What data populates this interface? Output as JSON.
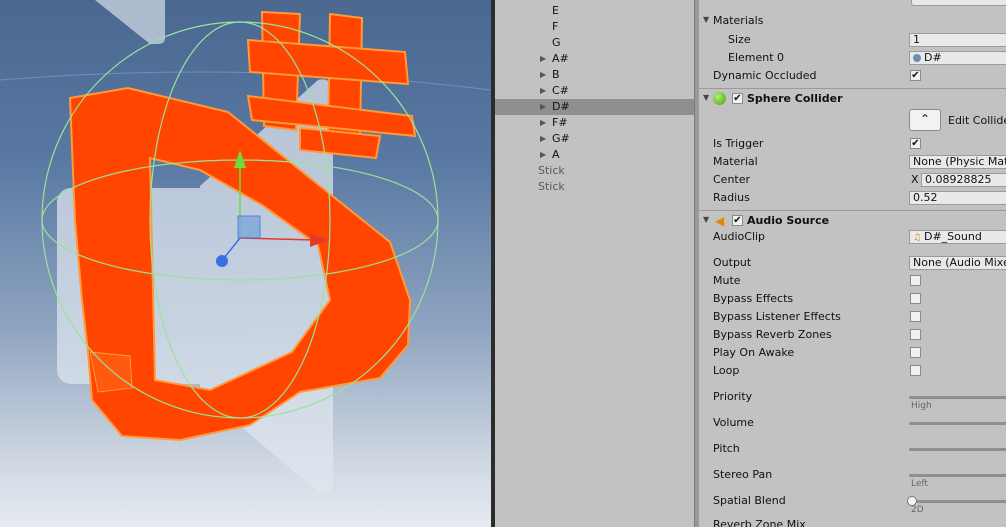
{
  "hierarchy": {
    "items": [
      {
        "label": "E",
        "expandable": false,
        "selected": false,
        "dim": false
      },
      {
        "label": "F",
        "expandable": false,
        "selected": false,
        "dim": false
      },
      {
        "label": "G",
        "expandable": false,
        "selected": false,
        "dim": false
      },
      {
        "label": "A#",
        "expandable": true,
        "selected": false,
        "dim": false
      },
      {
        "label": "B",
        "expandable": true,
        "selected": false,
        "dim": false
      },
      {
        "label": "C#",
        "expandable": true,
        "selected": false,
        "dim": false
      },
      {
        "label": "D#",
        "expandable": true,
        "selected": true,
        "dim": false
      },
      {
        "label": "F#",
        "expandable": true,
        "selected": false,
        "dim": false
      },
      {
        "label": "G#",
        "expandable": true,
        "selected": false,
        "dim": false
      },
      {
        "label": "A",
        "expandable": true,
        "selected": false,
        "dim": false
      },
      {
        "label": "Stick",
        "expandable": false,
        "selected": false,
        "dim": true
      },
      {
        "label": "Stick",
        "expandable": false,
        "selected": false,
        "dim": true
      }
    ]
  },
  "inspector": {
    "mesh_renderer": {
      "materials_label": "Materials",
      "size_label": "Size",
      "size_value": "1",
      "element0_label": "Element 0",
      "element0_value": "D#",
      "dynamic_occluded_label": "Dynamic Occluded",
      "dynamic_occluded_checked": true
    },
    "sphere_collider": {
      "title": "Sphere Collider",
      "enabled": true,
      "edit_collider_label": "Edit Collider",
      "is_trigger_label": "Is Trigger",
      "is_trigger_checked": true,
      "material_label": "Material",
      "material_value": "None (Physic Material)",
      "center_label": "Center",
      "center_axis": "X",
      "center_x": "0.08928825",
      "radius_label": "Radius",
      "radius_value": "0.52"
    },
    "audio_source": {
      "title": "Audio Source",
      "enabled": true,
      "audioclip_label": "AudioClip",
      "audioclip_value": "D#_Sound",
      "output_label": "Output",
      "output_value": "None (Audio Mixer Group)",
      "mute_label": "Mute",
      "bypass_effects_label": "Bypass Effects",
      "bypass_listener_label": "Bypass Listener Effects",
      "bypass_reverb_label": "Bypass Reverb Zones",
      "play_on_awake_label": "Play On Awake",
      "loop_label": "Loop",
      "priority_label": "Priority",
      "priority_hint": "High",
      "volume_label": "Volume",
      "pitch_label": "Pitch",
      "stereo_pan_label": "Stereo Pan",
      "stereo_pan_hint": "Left",
      "spatial_blend_label": "Spatial Blend",
      "spatial_blend_hint": "2D",
      "spatial_blend_value": 0.0,
      "reverb_zone_mix_label": "Reverb Zone Mix"
    }
  },
  "colors": {
    "glyph_fill": "#ff4500",
    "glyph_outline": "#ff8a2a",
    "gizmo_green": "#7fe07f",
    "panel_bg": "#c2c2c2"
  }
}
